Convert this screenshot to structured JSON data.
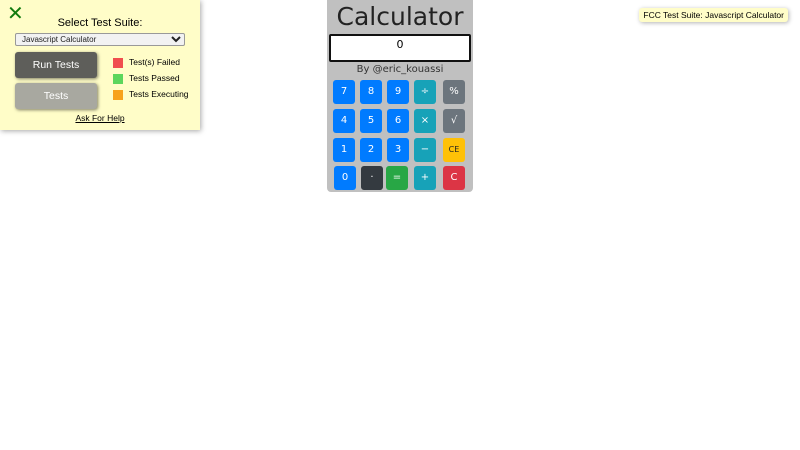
{
  "fcc_panel": {
    "close_glyph": "✕",
    "title": "Select Test Suite:",
    "selected_suite": "Javascript Calculator",
    "run_tests_label": "Run Tests",
    "tests_label": "Tests",
    "legend": {
      "failed": "Test(s) Failed",
      "passed": "Tests Passed",
      "executing": "Tests Executing"
    },
    "help_link": "Ask For Help",
    "badge": "FCC Test Suite: Javascript Calculator"
  },
  "calculator": {
    "title": "Calculator",
    "display_value": "0",
    "author": "By @eric_kouassi",
    "keys": {
      "seven": "7",
      "eight": "8",
      "nine": "9",
      "divide": "÷",
      "percent": "%",
      "four": "4",
      "five": "5",
      "six": "6",
      "multiply": "×",
      "sqrt": "√",
      "one": "1",
      "two": "2",
      "three": "3",
      "subtract": "−",
      "clear_entry": "CE",
      "zero": "0",
      "decimal": "·",
      "equals": "=",
      "add": "+",
      "clear": "C"
    }
  },
  "colors": {
    "panel_bg": "#fffdc8",
    "failed": "#f04e4e",
    "passed": "#5cd65c",
    "executing": "#f7a21b",
    "key_number": "#007bff",
    "key_operator": "#17a2b8",
    "key_function": "#6c757d",
    "key_ce": "#ffc107",
    "key_decimal": "#343a40",
    "key_equals": "#28a745",
    "key_clear": "#dc3545"
  },
  "icons": {
    "close": "close-icon",
    "dropdown": "chevron-down-icon"
  }
}
